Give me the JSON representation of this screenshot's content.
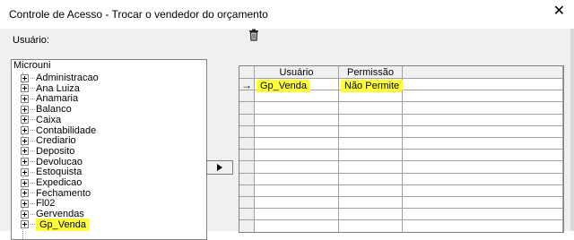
{
  "window": {
    "title": "Controle de Acesso - Trocar o vendedor do orçamento",
    "close_glyph": "✕"
  },
  "user_label": "Usuário:",
  "tree": {
    "root": "Microuni",
    "items": [
      "Administracao",
      "Ana Luiza",
      "Anamaria",
      "Balanco",
      "Caixa",
      "Contabilidade",
      "Crediario",
      "Deposito",
      "Devolucao",
      "Estoquista",
      "Expedicao",
      "Fechamento",
      "Fl02",
      "Gervendas",
      "Gp_Venda"
    ],
    "highlighted": "Gp_Venda"
  },
  "grid": {
    "columns": [
      "Usuário",
      "Permissão"
    ],
    "rows": [
      {
        "usuario": "Gp_Venda",
        "permissao": "Não Permite",
        "current": true
      }
    ],
    "current_row_glyph": "→"
  },
  "colors": {
    "highlight": "#ffff3a",
    "chrome": "#f0f0f0",
    "border": "#828282"
  },
  "icons": {
    "delete": "trash-icon",
    "move_right": "play-right-icon"
  }
}
